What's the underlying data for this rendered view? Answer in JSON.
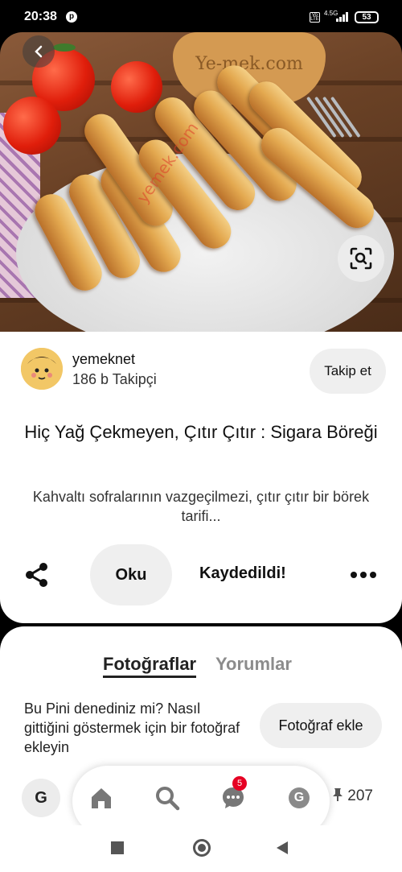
{
  "status_bar": {
    "time": "20:38",
    "pinterest_glyph": "p",
    "volte": "Vo LTE",
    "network": "4.5G",
    "battery": "53"
  },
  "hero": {
    "watermark_text": "yemek.com",
    "board_text": "Ye-mek.com"
  },
  "pin": {
    "author_name": "yemeknet",
    "followers": "186 b Takipçi",
    "follow_label": "Takip et",
    "title": "Hiç Yağ Çekmeyen, Çıtır Çıtır : Sigara Böreği",
    "description": "Kahvaltı sofralarının vazgeçilmezi, çıtır çıtır bir börek tarifi..."
  },
  "actions": {
    "read_label": "Oku",
    "saved_label": "Kaydedildi!"
  },
  "photos_panel": {
    "tab_photos": "Fotoğraflar",
    "tab_comments": "Yorumlar",
    "try_prompt": "Bu Pini denediniz mi? Nasıl gittiğini göstermek için bir fotoğraf ekleyin",
    "add_photo_label": "Fotoğraf ekle"
  },
  "bottom_nav": {
    "left_avatar_letter": "G",
    "messages_badge": "5",
    "profile_letter": "G",
    "pin_count": "207"
  },
  "colors": {
    "accent_red": "#e60023",
    "button_gray": "#efefef"
  }
}
